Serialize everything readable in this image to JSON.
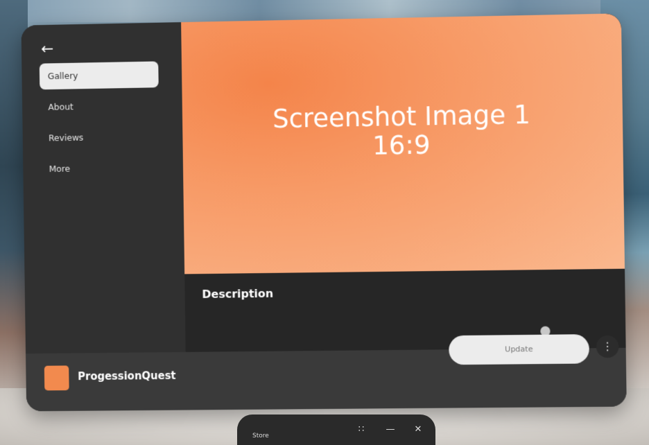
{
  "sidebar": {
    "back_icon": "arrow-left-icon",
    "items": [
      {
        "label": "Gallery",
        "active": true
      },
      {
        "label": "About",
        "active": false
      },
      {
        "label": "Reviews",
        "active": false
      },
      {
        "label": "More",
        "active": false
      }
    ]
  },
  "hero": {
    "title": "Screenshot Image 1",
    "subtitle": "16:9",
    "accent_color": "#f4844a"
  },
  "description": {
    "heading": "Description"
  },
  "footer": {
    "app_name": "ProgessionQuest",
    "update_label": "Update",
    "more_icon": "vertical-dots-icon"
  },
  "taskbar": {
    "label": "Store",
    "icons": [
      "resize-icon",
      "minimize-icon",
      "close-icon"
    ]
  }
}
